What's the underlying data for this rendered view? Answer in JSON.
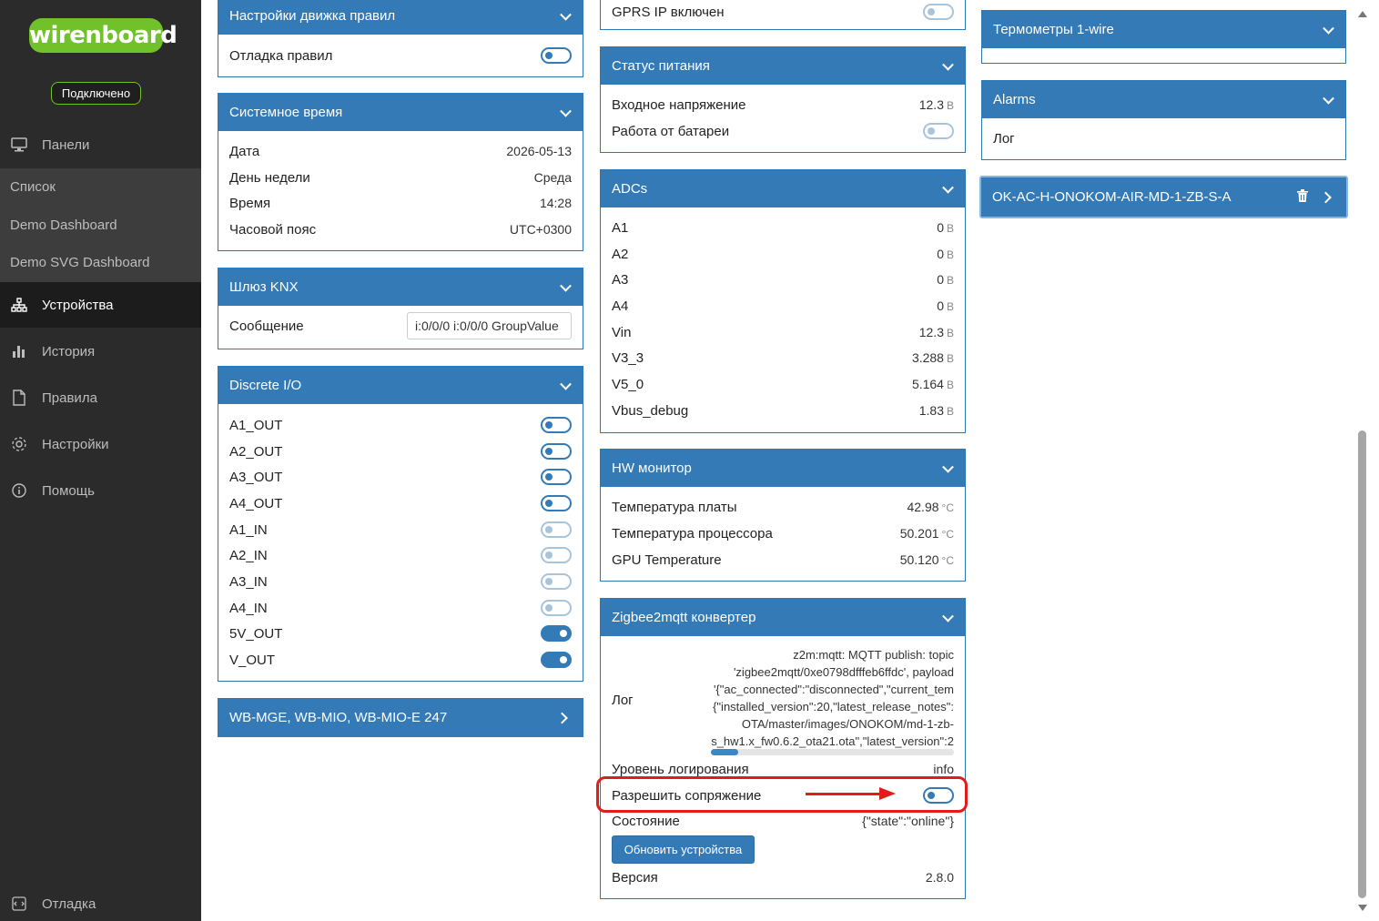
{
  "sidebar": {
    "logo": "wirenboard",
    "status": "Подключено",
    "nav": {
      "panels": "Панели",
      "devices": "Устройства",
      "history": "История",
      "rules": "Правила",
      "settings": "Настройки",
      "help": "Помощь",
      "debug": "Отладка"
    },
    "submenu": [
      "Список",
      "Demo Dashboard",
      "Demo SVG Dashboard"
    ]
  },
  "col1": {
    "rules_engine": {
      "title": "Настройки движка правил",
      "debug_label": "Отладка правил"
    },
    "system_time": {
      "title": "Системное время",
      "rows": [
        {
          "label": "Дата",
          "value": "2026-05-13"
        },
        {
          "label": "День недели",
          "value": "Среда"
        },
        {
          "label": "Время",
          "value": "14:28"
        },
        {
          "label": "Часовой пояс",
          "value": "UTC+0300"
        }
      ]
    },
    "knx": {
      "title": "Шлюз KNX",
      "message_label": "Сообщение",
      "message_value": "i:0/0/0 i:0/0/0 GroupValue"
    },
    "discrete_io": {
      "title": "Discrete I/O",
      "rows": [
        {
          "label": "A1_OUT",
          "state": "off"
        },
        {
          "label": "A2_OUT",
          "state": "off"
        },
        {
          "label": "A3_OUT",
          "state": "off"
        },
        {
          "label": "A4_OUT",
          "state": "off"
        },
        {
          "label": "A1_IN",
          "state": "disabled"
        },
        {
          "label": "A2_IN",
          "state": "disabled"
        },
        {
          "label": "A3_IN",
          "state": "disabled"
        },
        {
          "label": "A4_IN",
          "state": "disabled"
        },
        {
          "label": "5V_OUT",
          "state": "on"
        },
        {
          "label": "V_OUT",
          "state": "on"
        }
      ]
    },
    "wb_mge": {
      "title": "WB-MGE, WB-MIO, WB-MIO-E 247"
    }
  },
  "col2": {
    "gprs_partial": "GPRS IP включен",
    "power": {
      "title": "Статус питания",
      "input_voltage_label": "Входное напряжение",
      "input_voltage_value": "12.3",
      "unit": "В",
      "battery_label": "Работа от батареи"
    },
    "adcs": {
      "title": "ADCs",
      "unit": "В",
      "rows": [
        {
          "label": "A1",
          "value": "0"
        },
        {
          "label": "A2",
          "value": "0"
        },
        {
          "label": "A3",
          "value": "0"
        },
        {
          "label": "A4",
          "value": "0"
        },
        {
          "label": "Vin",
          "value": "12.3"
        },
        {
          "label": "V3_3",
          "value": "3.288"
        },
        {
          "label": "V5_0",
          "value": "5.164"
        },
        {
          "label": "Vbus_debug",
          "value": "1.83"
        }
      ]
    },
    "hw": {
      "title": "HW монитор",
      "unit": "°C",
      "rows": [
        {
          "label": "Температура платы",
          "value": "42.98"
        },
        {
          "label": "Температура процессора",
          "value": "50.201"
        },
        {
          "label": "GPU Temperature",
          "value": "50.120"
        }
      ]
    },
    "zigbee": {
      "title": "Zigbee2mqtt конвертер",
      "log_label": "Лог",
      "log_lines": [
        "z2m:mqtt: MQTT publish: topic",
        "'zigbee2mqtt/0xe0798dfffeb6ffdc', payload",
        "'{\"ac_connected\":\"disconnected\",\"current_tem",
        "{\"installed_version\":20,\"latest_release_notes\":",
        "OTA/master/images/ONOKOM/md-1-zb-",
        "s_hw1.x_fw0.6.2_ota21.ota\",\"latest_version\":2"
      ],
      "log_level_label": "Уровень логирования",
      "log_level_value": "info",
      "permit_join_label": "Разрешить сопряжение",
      "state_label": "Состояние",
      "state_value": "{\"state\":\"online\"}",
      "update_button": "Обновить устройства",
      "version_label": "Версия",
      "version_value": "2.8.0"
    }
  },
  "col3": {
    "thermometers": {
      "title": "Термометры 1-wire"
    },
    "alarms": {
      "title": "Alarms",
      "log_label": "Лог"
    },
    "device": {
      "title": "OK-AC-H-ONOKOM-AIR-MD-1-ZB-S-A"
    }
  },
  "colors": {
    "accent": "#337ab7",
    "brand": "#71c12b",
    "highlight": "#e21b1b"
  }
}
